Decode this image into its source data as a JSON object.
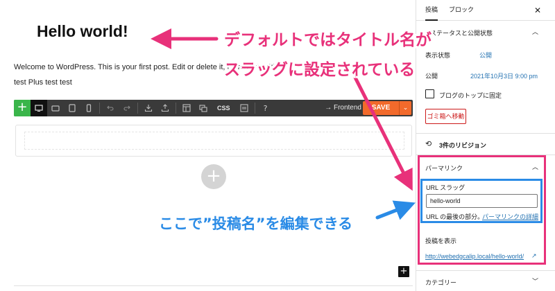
{
  "editor": {
    "title": "Hello world!",
    "paragraph1": "Welcome to WordPress. This is your first post. Edit or delete it, then start writing!",
    "paragraph2": "test Plus test test",
    "toolbar": {
      "add_icon": "+",
      "css_label": "CSS",
      "help_label": "?",
      "frontend_label": "→ Frontend",
      "save_label": "SAVE",
      "save_toggle": "⌄"
    },
    "add_block_icon": "+",
    "small_add_icon": "+"
  },
  "sidebar": {
    "tabs": [
      "投稿",
      "ブロック"
    ],
    "close_icon": "✕",
    "status_panel": {
      "title": "ステータスと公開状態",
      "visibility_label": "表示状態",
      "visibility_value": "公開",
      "publish_label": "公開",
      "publish_value": "2021年10月3日 9:00 pm",
      "sticky_label": "ブログのトップに固定",
      "trash_label": "ゴミ箱へ移動"
    },
    "revisions_label": "3件のリビジョン",
    "permalink_panel": {
      "title": "パーマリンク",
      "slug_label": "URL スラッグ",
      "slug_value": "hello-world",
      "help_text": "URL の最後の部分。",
      "help_link": "パーマリンクの詳細",
      "view_post_label": "投稿を表示",
      "post_url": "http://webedgcalip.local/hello-world/"
    },
    "categories_label": "カテゴリー"
  },
  "annotations": {
    "top_line1": "デフォルトではタイトル名が",
    "top_line2": "スラッグに設定されている",
    "bottom": "ここで”投稿名”を編集できる"
  },
  "colors": {
    "annotation_pink": "#e8317a",
    "annotation_blue": "#2a8be6",
    "save_orange": "#f26a2b",
    "add_green": "#3ab54a",
    "link_blue": "#2271b1",
    "trash_red": "#cc1818"
  }
}
